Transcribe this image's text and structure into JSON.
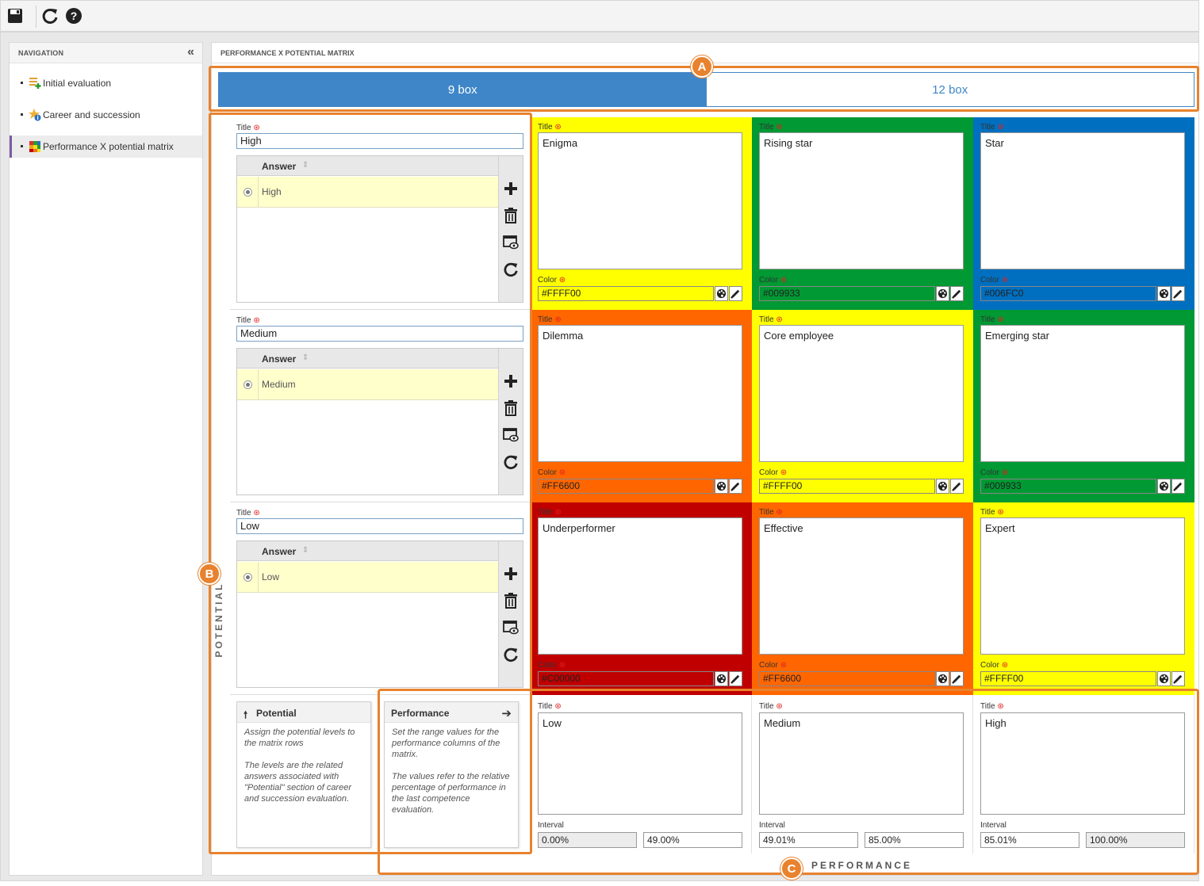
{
  "navigation": {
    "header": "NAVIGATION",
    "items": [
      {
        "label": "Initial evaluation",
        "icon": "evaluation-icon"
      },
      {
        "label": "Career and succession",
        "icon": "star-info-icon"
      },
      {
        "label": "Performance X potential matrix",
        "icon": "matrix-icon",
        "active": true
      }
    ]
  },
  "main": {
    "header": "PERFORMANCE X POTENTIAL MATRIX",
    "tabs": [
      {
        "label": "9 box",
        "active": true
      },
      {
        "label": "12 box",
        "active": false
      }
    ],
    "potential_axis_label": "POTENTIAL",
    "performance_axis_label": "PERFORMANCE",
    "title_label": "Title",
    "color_label": "Color",
    "interval_label": "Interval",
    "answer_column": "Answer",
    "rows": [
      {
        "title": "High",
        "answer": "High"
      },
      {
        "title": "Medium",
        "answer": "Medium"
      },
      {
        "title": "Low",
        "answer": "Low"
      }
    ],
    "matrix": [
      [
        {
          "title": "Enigma",
          "color": "#FFFF00"
        },
        {
          "title": "Rising star",
          "color": "#009933"
        },
        {
          "title": "Star",
          "color": "#006FC0"
        }
      ],
      [
        {
          "title": "Dilemma",
          "color": "#FF6600"
        },
        {
          "title": "Core employee",
          "color": "#FFFF00"
        },
        {
          "title": "Emerging star",
          "color": "#009933"
        }
      ],
      [
        {
          "title": "Underperformer",
          "color": "#C00000"
        },
        {
          "title": "Effective",
          "color": "#FF6600"
        },
        {
          "title": "Expert",
          "color": "#FFFF00"
        }
      ]
    ],
    "performance_columns": [
      {
        "title": "Low",
        "from": "0.00%",
        "to": "49.00%"
      },
      {
        "title": "Medium",
        "from": "49.01%",
        "to": "85.00%"
      },
      {
        "title": "High",
        "from": "85.01%",
        "to": "100.00%"
      }
    ],
    "help_potential": {
      "title": "Potential",
      "body1": "Assign the potential levels to the matrix rows",
      "body2": "The levels are the related answers associated with \"Potential\" section of career and succession evaluation."
    },
    "help_performance": {
      "title": "Performance",
      "body1": "Set the range values for the performance columns of the matrix.",
      "body2": "The values refer to the relative percentage of performance in the last competence evaluation."
    }
  },
  "annotations": [
    "A",
    "B",
    "C"
  ],
  "colors": {
    "accent": "#3f86c8",
    "annotation": "#e8822e"
  }
}
